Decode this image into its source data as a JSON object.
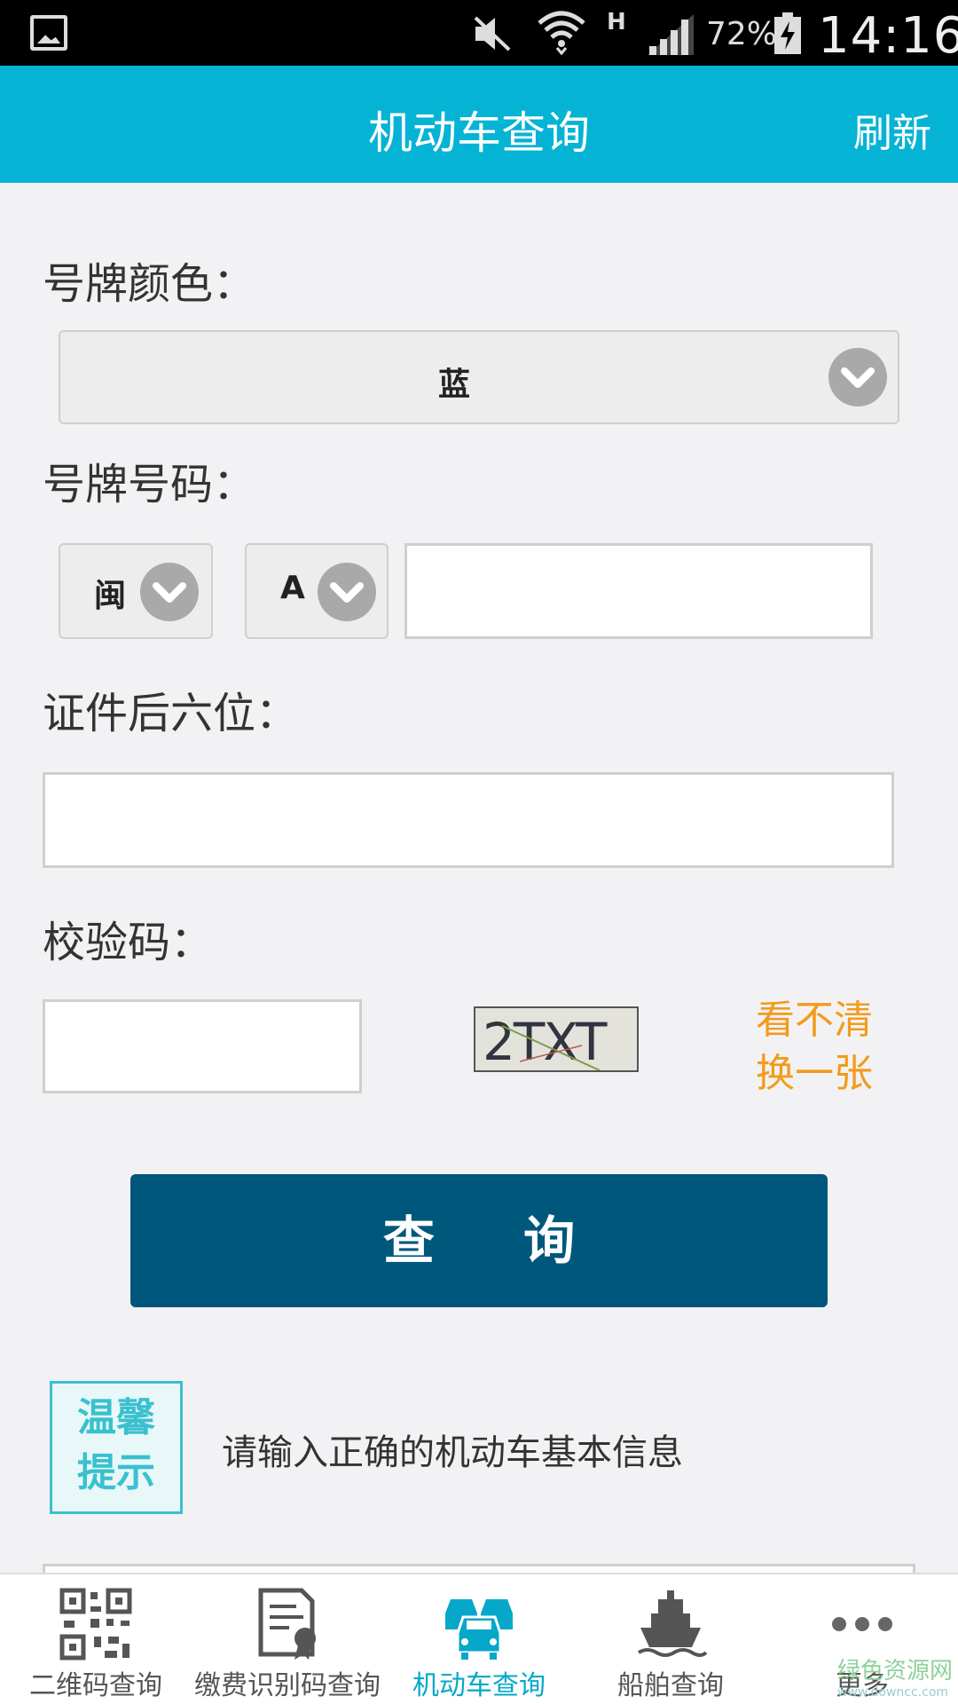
{
  "status_bar": {
    "battery": "72%",
    "network": "H",
    "time": "14:16"
  },
  "header": {
    "title": "机动车查询",
    "refresh": "刷新"
  },
  "form": {
    "plate_color_label": "号牌颜色：",
    "plate_color_value": "蓝",
    "plate_number_label": "号牌号码：",
    "province_value": "闽",
    "letter_value": "A",
    "plate_number_value": "",
    "id_last6_label": "证件后六位：",
    "id_last6_value": "",
    "captcha_label": "校验码：",
    "captcha_value": "",
    "captcha_image_text": "2TXT",
    "captcha_refresh_line1": "看不清",
    "captcha_refresh_line2": "换一张",
    "submit": "查 询"
  },
  "tip": {
    "badge_line1": "温馨",
    "badge_line2": "提示",
    "text": "请输入正确的机动车基本信息"
  },
  "bottom_nav": {
    "items": [
      {
        "label": "二维码查询",
        "icon": "qrcode-icon"
      },
      {
        "label": "缴费识别码查询",
        "icon": "document-icon"
      },
      {
        "label": "机动车查询",
        "icon": "cars-icon",
        "active": true
      },
      {
        "label": "船舶查询",
        "icon": "ship-icon"
      },
      {
        "label": "更多",
        "icon": "more-icon"
      }
    ]
  },
  "watermark": {
    "line1": "绿色资源网",
    "line2": "www.downcc.com"
  },
  "colors": {
    "header": "#05b3d5",
    "button": "#00577c",
    "accent": "#f29b1b"
  }
}
